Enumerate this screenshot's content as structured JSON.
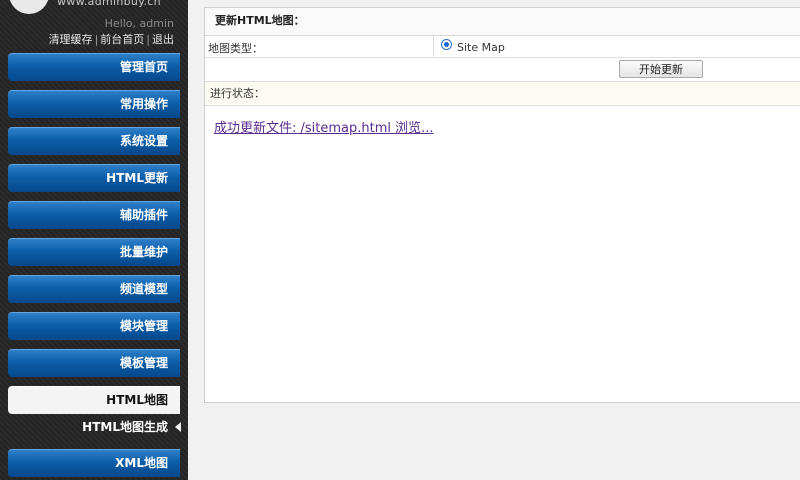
{
  "header": {
    "site_url": "www.adminbuy.cn",
    "greeting": "Hello, admin",
    "links": [
      {
        "label": "清理缓存"
      },
      {
        "label": "前台首页"
      },
      {
        "label": "退出"
      }
    ],
    "separator": "|"
  },
  "sidebar": {
    "items": [
      {
        "label": "管理首页",
        "active": false
      },
      {
        "label": "常用操作",
        "active": false
      },
      {
        "label": "系统设置",
        "active": false
      },
      {
        "label": "HTML更新",
        "active": false
      },
      {
        "label": "辅助插件",
        "active": false
      },
      {
        "label": "批量维护",
        "active": false
      },
      {
        "label": "频道模型",
        "active": false
      },
      {
        "label": "模块管理",
        "active": false
      },
      {
        "label": "模板管理",
        "active": false
      },
      {
        "label": "HTML地图",
        "active": true
      },
      {
        "label": "XML地图",
        "active": false
      }
    ],
    "subitem": {
      "label": "HTML地图生成"
    }
  },
  "panel": {
    "title": "更新HTML地图：",
    "map_type_label": "地图类型：",
    "map_type_option": "Site Map",
    "map_type_selected": true,
    "start_button": "开始更新",
    "status_label": "进行状态：",
    "result_link": "成功更新文件: /sitemap.html 浏览..."
  },
  "colors": {
    "sidebar_bg": "#262626",
    "nav_button": "#0d5ea9",
    "active_nav": "#f4f4f4",
    "link": "#5b2d91",
    "status_bg": "#fbfbf1"
  }
}
